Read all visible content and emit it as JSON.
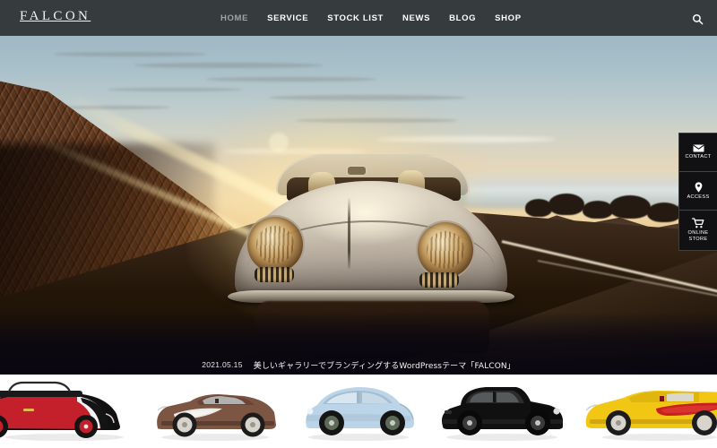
{
  "header": {
    "brand": "FALCON",
    "nav": [
      {
        "label": "HOME",
        "active": true
      },
      {
        "label": "SERVICE",
        "active": false
      },
      {
        "label": "STOCK LIST",
        "active": false
      },
      {
        "label": "NEWS",
        "active": false
      },
      {
        "label": "BLOG",
        "active": false
      },
      {
        "label": "SHOP",
        "active": false
      }
    ],
    "search_icon": "search-icon"
  },
  "hero": {
    "alt": "Silver Porsche 356 Speedster driving on a coastal road at sunset",
    "scene": "sunset-coastal-road"
  },
  "side_tabs": [
    {
      "label": "CONTACT",
      "icon": "envelope-icon"
    },
    {
      "label": "ACCESS",
      "icon": "map-pin-icon"
    },
    {
      "label": "ONLINE\nSTORE",
      "icon": "shopping-cart-icon"
    }
  ],
  "news": {
    "date": "2021.05.15",
    "title": "美しいギャラリーでブランディングするWordPressテーマ「FALCON」"
  },
  "gallery": [
    {
      "name": "red-beetle-convertible",
      "body": "#c4202c",
      "accent": "#111111",
      "wheel": "#c4202c"
    },
    {
      "name": "brown-corvette-roadster",
      "body": "#7d5543",
      "accent": "#e8e4de",
      "wheel": "#d8d4cc"
    },
    {
      "name": "blue-beetle",
      "body": "#bcd4e8",
      "accent": "#9fc0d8",
      "wheel": "#1a1a1a"
    },
    {
      "name": "black-sedan",
      "body": "#101010",
      "accent": "#2a2a2a",
      "wheel": "#0a0a0a"
    },
    {
      "name": "yellow-corvette",
      "body": "#f2c714",
      "accent": "#c8201f",
      "wheel": "#d8d4cc"
    }
  ],
  "colors": {
    "header_bg": "#363b3e",
    "side_tab_bg": "#111113",
    "nav_text": "#ffffff",
    "nav_text_dim": "#9ea3a6",
    "gallery_bg": "#ffffff"
  }
}
